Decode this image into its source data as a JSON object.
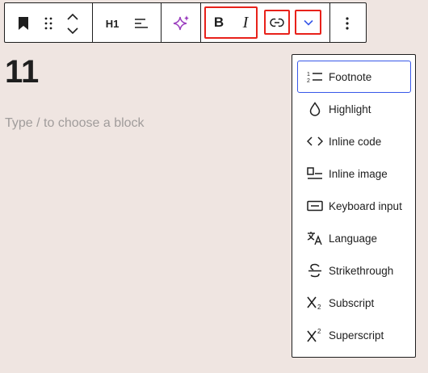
{
  "toolbar": {
    "block_icon": "bookmark-icon",
    "drag_icon": "drag-handle-icon",
    "move_icon": "chevron-up-down-icon",
    "heading_level": "H1",
    "align_icon": "align-left-icon",
    "ai_icon": "sparkles-icon",
    "bold_label": "B",
    "italic_label": "I",
    "link_icon": "link-icon",
    "more_formats_icon": "chevron-down-icon",
    "options_icon": "more-vertical-icon"
  },
  "content": {
    "heading_text": "11",
    "placeholder": "Type / to choose a block"
  },
  "menu": {
    "items": [
      {
        "label": "Footnote",
        "icon": "footnote-icon",
        "focused": true
      },
      {
        "label": "Highlight",
        "icon": "droplet-icon"
      },
      {
        "label": "Inline code",
        "icon": "code-icon"
      },
      {
        "label": "Inline image",
        "icon": "image-icon"
      },
      {
        "label": "Keyboard input",
        "icon": "keyboard-icon"
      },
      {
        "label": "Language",
        "icon": "language-icon"
      },
      {
        "label": "Strikethrough",
        "icon": "strikethrough-icon"
      },
      {
        "label": "Subscript",
        "icon": "subscript-icon"
      },
      {
        "label": "Superscript",
        "icon": "superscript-icon"
      }
    ]
  },
  "colors": {
    "background": "#efe5e1",
    "highlight_outline": "#e8211a",
    "focus_outline": "#3858e9",
    "ai_icon": "#9b3fbf",
    "chevron_accent": "#3858e9"
  }
}
